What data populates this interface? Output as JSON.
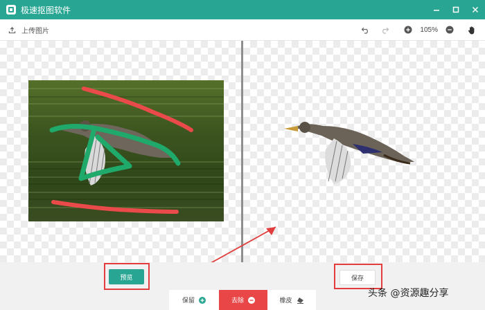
{
  "app": {
    "title": "极速抠图软件",
    "brand_color": "#29a693"
  },
  "toolbar": {
    "upload_label": "上传图片",
    "zoom": "105%",
    "icons": [
      "upload-icon",
      "undo-icon",
      "redo-icon",
      "zoom-in-icon",
      "zoom-out-icon",
      "hand-icon"
    ]
  },
  "actions": {
    "preview_label": "预览",
    "save_label": "保存"
  },
  "modes": [
    {
      "label": "保留",
      "icon": "plus-icon",
      "color": "#29a693",
      "active": false
    },
    {
      "label": "去除",
      "icon": "minus-icon",
      "color": "#e94747",
      "active": true
    },
    {
      "label": "橡皮",
      "icon": "eraser-icon",
      "color": "#555555",
      "active": false
    }
  ],
  "watermark": "头条 @资源趣分享",
  "colors": {
    "keep_stroke": "#1fa96a",
    "remove_stroke": "#ea4a4a",
    "annotation": "#e23c3c"
  }
}
